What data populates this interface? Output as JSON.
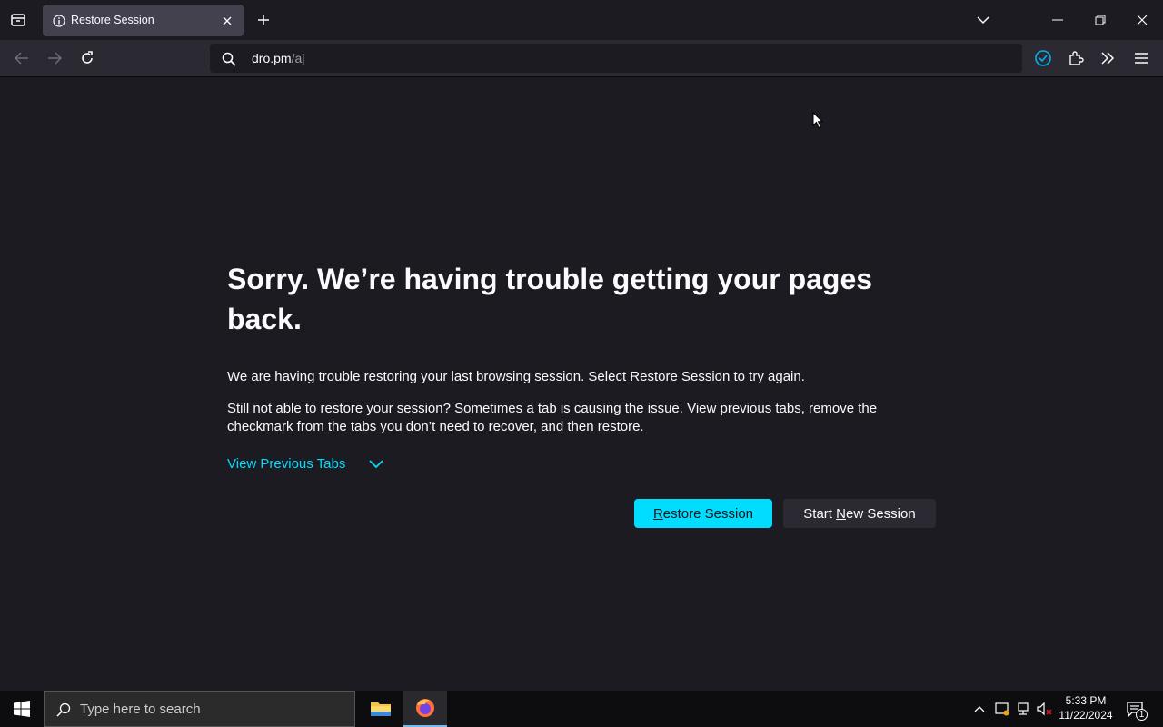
{
  "browser": {
    "tab": {
      "title": "Restore Session"
    },
    "url": {
      "host": "dro.pm",
      "path": "/aj"
    }
  },
  "page": {
    "heading": "Sorry. We’re having trouble getting your pages back.",
    "para1": "We are having trouble restoring your last browsing session. Select Restore Session to try again.",
    "para2": "Still not able to restore your session? Sometimes a tab is causing the issue. View previous tabs, remove the checkmark from the tabs you don’t need to recover, and then restore.",
    "view_tabs_link": "View Previous Tabs",
    "restore_btn": {
      "accel": "R",
      "rest": "estore Session"
    },
    "new_btn": {
      "pre": "Start ",
      "accel": "N",
      "post": "ew Session"
    }
  },
  "taskbar": {
    "search_placeholder": "Type here to search",
    "time": "5:33 PM",
    "date": "11/22/2024",
    "notification_count": "1"
  },
  "colors": {
    "accent": "#00ddff",
    "background": "#1c1b22",
    "toolbar": "#2b2a33"
  }
}
